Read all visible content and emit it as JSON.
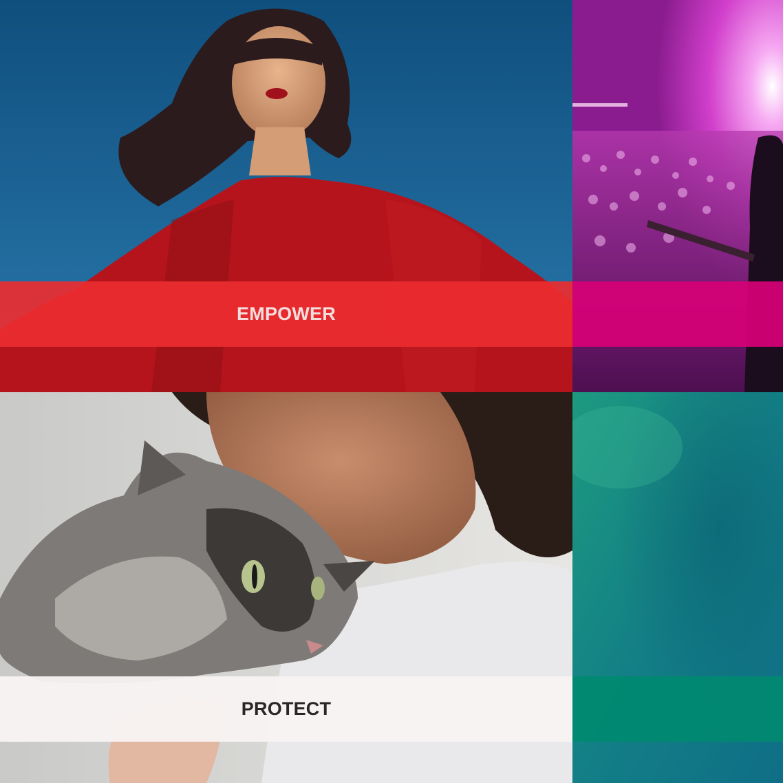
{
  "tiles": {
    "empower": {
      "label": "EMPOWER",
      "band_color": "#ec2c30",
      "photo_icon": "woman-red-dress-photo"
    },
    "concert": {
      "band_color": "#d60076",
      "photo_icon": "concert-crowd-photo"
    },
    "protect": {
      "label": "PROTECT",
      "band_color": "#f8f3f3",
      "photo_icon": "person-hugging-cat-photo"
    },
    "teal": {
      "band_color": "#008a70",
      "photo_icon": "teal-texture-photo"
    }
  }
}
